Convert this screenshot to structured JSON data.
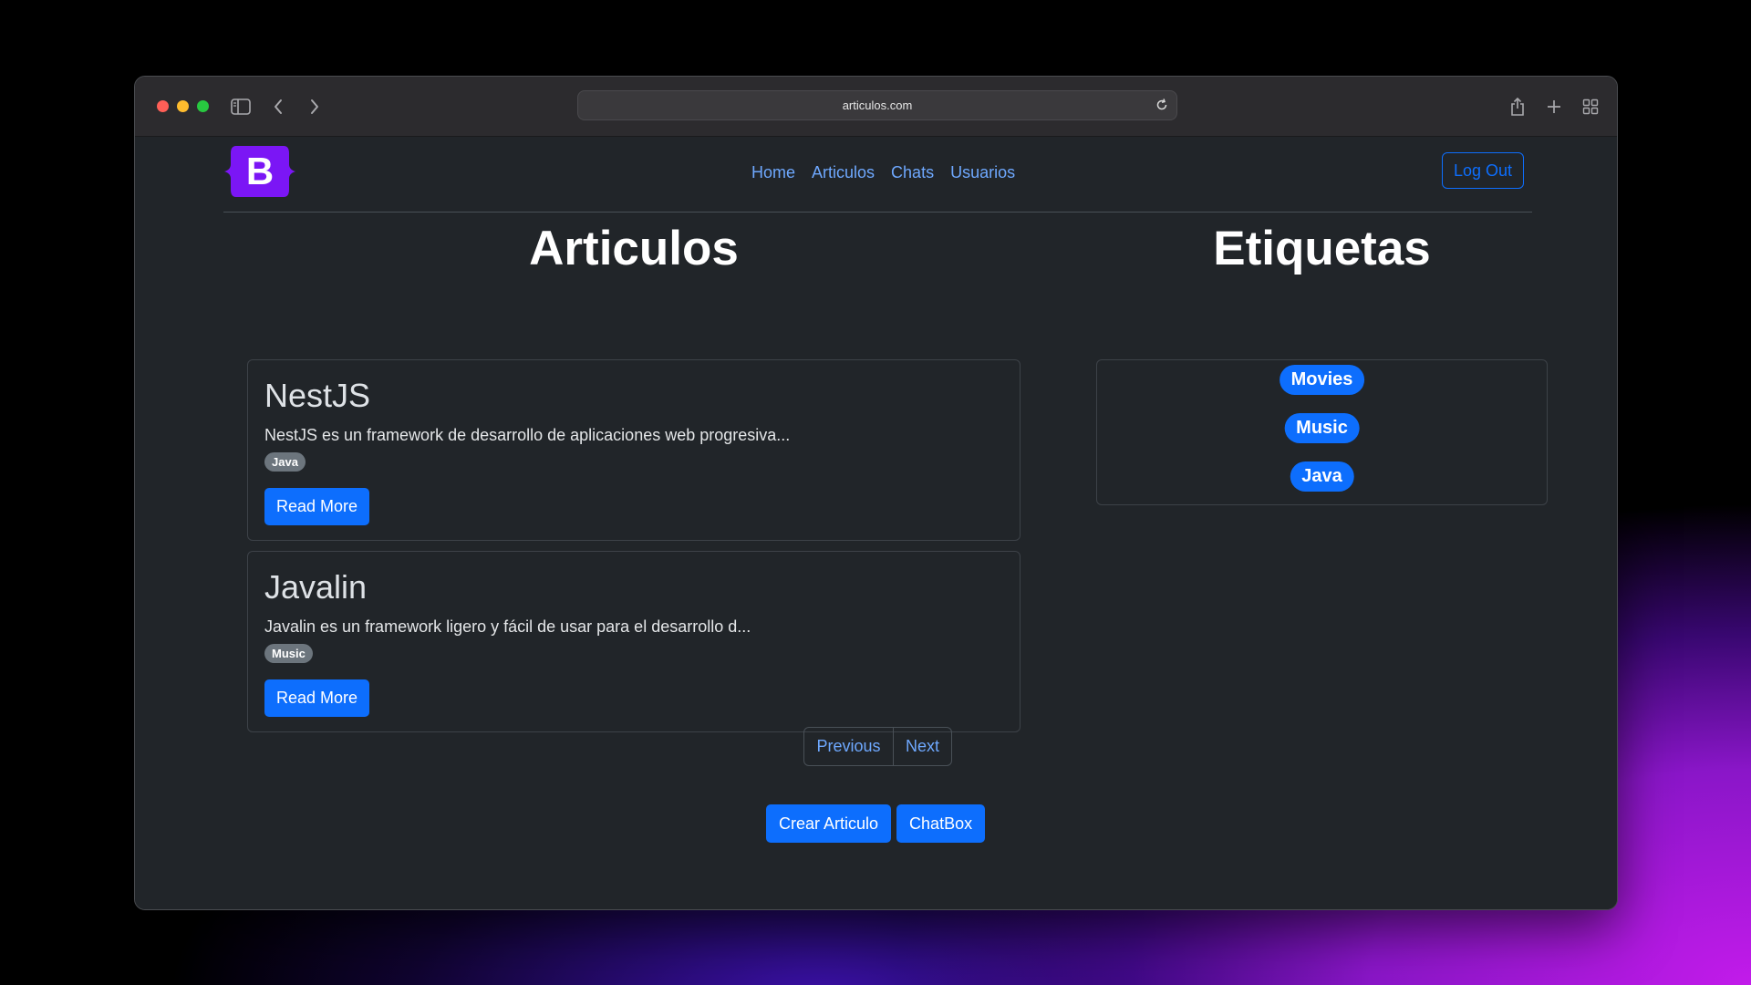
{
  "browser": {
    "url": "articulos.com"
  },
  "navbar": {
    "logo_letter": "B",
    "links": [
      "Home",
      "Articulos",
      "Chats",
      "Usuarios"
    ],
    "logout_label": "Log Out"
  },
  "articles_section": {
    "title": "Articulos",
    "articles": [
      {
        "title": "NestJS",
        "excerpt": "NestJS es un framework de desarrollo de aplicaciones web progresiva...",
        "tag": "Java",
        "button": "Read More"
      },
      {
        "title": "Javalin",
        "excerpt": "Javalin es un framework ligero y fácil de usar para el desarrollo d...",
        "tag": "Music",
        "button": "Read More"
      }
    ],
    "pagination": {
      "previous": "Previous",
      "next": "Next"
    },
    "actions": {
      "create_article": "Crear Articulo",
      "chatbox": "ChatBox"
    }
  },
  "tags_section": {
    "title": "Etiquetas",
    "tags": [
      "Movies",
      "Music",
      "Java"
    ]
  },
  "colors": {
    "primary": "#0d6efd",
    "link": "#6ea8fe",
    "background": "#212529",
    "logo": "#7b16f5",
    "badge_secondary": "#6c757d"
  }
}
